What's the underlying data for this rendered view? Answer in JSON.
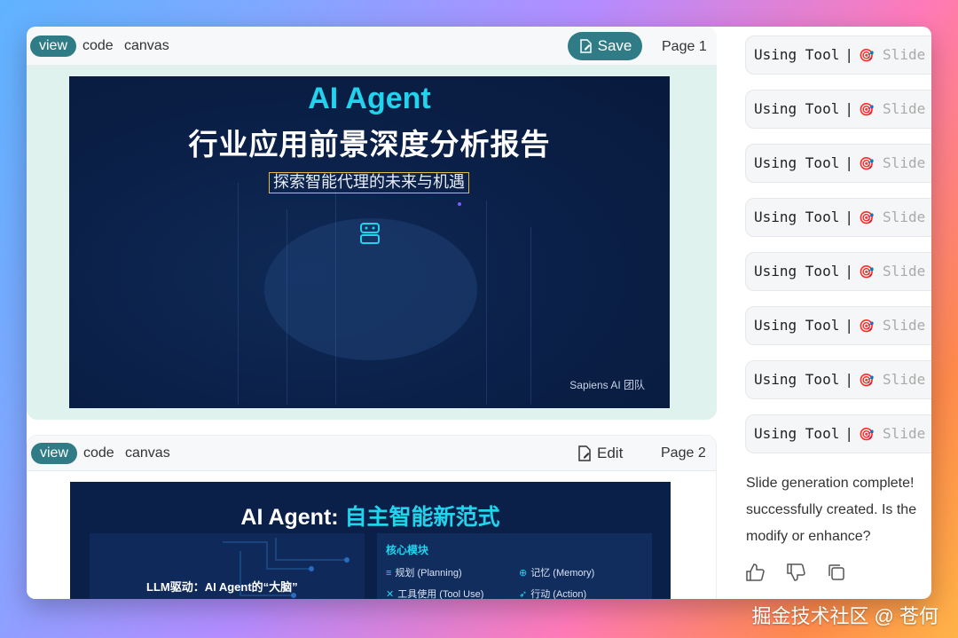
{
  "cards": [
    {
      "tabs": [
        "view",
        "code",
        "canvas"
      ],
      "action_label": "Save",
      "page_label": "Page 1",
      "slide": {
        "title_en": "AI Agent",
        "title_zh": "行业应用前景深度分析报告",
        "subtitle": "探索智能代理的未来与机遇",
        "footer": "Sapiens AI 团队"
      }
    },
    {
      "tabs": [
        "view",
        "code",
        "canvas"
      ],
      "action_label": "Edit",
      "page_label": "Page 2",
      "slide": {
        "title_prefix": "AI Agent: ",
        "title_highlight": "自主智能新范式",
        "left_label": "LLM驱动：AI Agent的“大脑”",
        "core_title": "核心模块",
        "items": [
          "规划 (Planning)",
          "记忆 (Memory)",
          "工具使用 (Tool Use)",
          "行动 (Action)"
        ]
      }
    }
  ],
  "tool_calls": [
    {
      "label": "Using Tool",
      "sep": "|",
      "tool": "Slide"
    },
    {
      "label": "Using Tool",
      "sep": "|",
      "tool": "Slide"
    },
    {
      "label": "Using Tool",
      "sep": "|",
      "tool": "Slide"
    },
    {
      "label": "Using Tool",
      "sep": "|",
      "tool": "Slide"
    },
    {
      "label": "Using Tool",
      "sep": "|",
      "tool": "Slide"
    },
    {
      "label": "Using Tool",
      "sep": "|",
      "tool": "Slide"
    },
    {
      "label": "Using Tool",
      "sep": "|",
      "tool": "Slide"
    },
    {
      "label": "Using Tool",
      "sep": "|",
      "tool": "Slide"
    }
  ],
  "message": {
    "line1": "Slide generation complete!",
    "line2": "successfully created. Is the",
    "line3": "modify or enhance?"
  },
  "watermark": "掘金技术社区 @ 苍何",
  "colors": {
    "accent": "#2f7c86",
    "slide_bg": "#0b2048",
    "cyan": "#22d3ee",
    "subtitle_border": "#e6b84a"
  }
}
